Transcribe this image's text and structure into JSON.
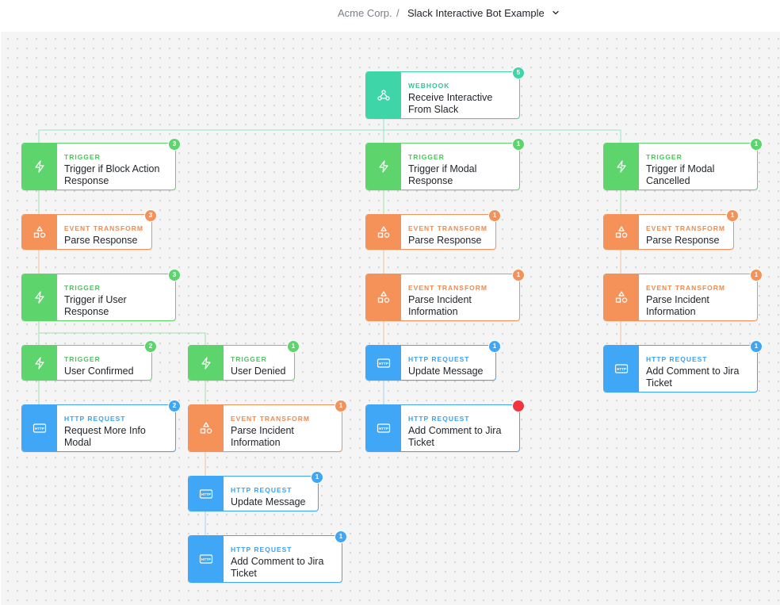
{
  "breadcrumb": {
    "org": "Acme Corp.",
    "separator": "/",
    "story": "Slack Interactive Bot Example"
  },
  "colors": {
    "webhook": "#3ed6a8",
    "trigger": "#5dd46c",
    "event_transform": "#f4925a",
    "http_request": "#3fa7f5",
    "error_badge": "#f2343f"
  },
  "icons": {
    "webhook": "webhook-icon",
    "trigger": "lightning-icon",
    "event_transform": "shapes-icon",
    "http_request": "http-icon"
  },
  "nodes": [
    {
      "id": "webhook",
      "type": "WEBHOOK",
      "name": "Receive Interactive From Slack",
      "badge": "5"
    },
    {
      "id": "trigger-block",
      "type": "TRIGGER",
      "name": "Trigger if Block Action Response",
      "badge": "3"
    },
    {
      "id": "parse-1",
      "type": "EVENT TRANSFORM",
      "name": "Parse Response",
      "badge": "3"
    },
    {
      "id": "trigger-user",
      "type": "TRIGGER",
      "name": "Trigger if User Response",
      "badge": "3"
    },
    {
      "id": "user-confirmed",
      "type": "TRIGGER",
      "name": "User Confirmed",
      "badge": "2"
    },
    {
      "id": "user-denied",
      "type": "TRIGGER",
      "name": "User Denied",
      "badge": "1"
    },
    {
      "id": "request-more-info",
      "type": "HTTP REQUEST",
      "name": "Request More Info Modal",
      "badge": "2"
    },
    {
      "id": "parse-incident-3",
      "type": "EVENT TRANSFORM",
      "name": "Parse Incident Information",
      "badge": "1"
    },
    {
      "id": "update-message-2",
      "type": "HTTP REQUEST",
      "name": "Update Message",
      "badge": "1"
    },
    {
      "id": "add-comment-3",
      "type": "HTTP REQUEST",
      "name": "Add Comment to Jira Ticket",
      "badge": "1"
    },
    {
      "id": "trigger-modal-resp",
      "type": "TRIGGER",
      "name": "Trigger if Modal Response",
      "badge": "1"
    },
    {
      "id": "parse-2",
      "type": "EVENT TRANSFORM",
      "name": "Parse Response",
      "badge": "1"
    },
    {
      "id": "parse-incident-1",
      "type": "EVENT TRANSFORM",
      "name": "Parse Incident Information",
      "badge": "1"
    },
    {
      "id": "update-message-1",
      "type": "HTTP REQUEST",
      "name": "Update Message",
      "badge": "1"
    },
    {
      "id": "add-comment-1",
      "type": "HTTP REQUEST",
      "name": "Add Comment to Jira Ticket",
      "badge": "",
      "error": true
    },
    {
      "id": "trigger-modal-cancel",
      "type": "TRIGGER",
      "name": "Trigger if Modal Cancelled",
      "badge": "1"
    },
    {
      "id": "parse-3",
      "type": "EVENT TRANSFORM",
      "name": "Parse Response",
      "badge": "1"
    },
    {
      "id": "parse-incident-2",
      "type": "EVENT TRANSFORM",
      "name": "Parse Incident Information",
      "badge": "1"
    },
    {
      "id": "add-comment-2",
      "type": "HTTP REQUEST",
      "name": "Add Comment to Jira Ticket",
      "badge": "1"
    }
  ]
}
